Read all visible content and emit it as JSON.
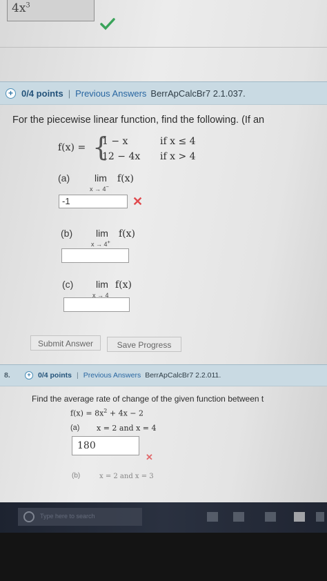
{
  "prev_answer": {
    "value": "4x",
    "exponent": "3"
  },
  "q7": {
    "points": "0/4 points",
    "separator": "|",
    "previous_answers": "Previous Answers",
    "code": "BerrApCalcBr7 2.1.037.",
    "prompt": "For the piecewise linear function, find the following. (If an",
    "func_name": "f(x) =",
    "piece1_expr": "1 − x",
    "piece1_cond": "if x ≤ 4",
    "piece2_expr": "12 − 4x",
    "piece2_cond": "if x > 4",
    "parts": [
      {
        "label": "(a)",
        "lim": "lim",
        "sub": "x → 4",
        "sup": "−",
        "fx": "f(x)",
        "answer": "-1",
        "marked_wrong": true
      },
      {
        "label": "(b)",
        "lim": "lim",
        "sub": "x → 4",
        "sup": "+",
        "fx": "f(x)",
        "answer": "",
        "marked_wrong": false
      },
      {
        "label": "(c)",
        "lim": "lim",
        "sub": "x → 4",
        "sup": "",
        "fx": "f(x)",
        "answer": "",
        "marked_wrong": false
      }
    ],
    "submit_label": "Submit Answer",
    "save_label": "Save Progress"
  },
  "q8": {
    "number": "8.",
    "points": "0/4 points",
    "separator": "|",
    "previous_answers": "Previous Answers",
    "code": "BerrApCalcBr7 2.2.011.",
    "prompt": "Find the average rate of change of the given function between t",
    "func": "f(x) = 8x",
    "func_exp": "2",
    "func_rest": " + 4x − 2",
    "part_a_label": "(a)",
    "part_a_text": "x = 2 and x = 4",
    "part_a_answer": "180",
    "part_b_label": "(b)",
    "part_b_text": "x = 2 and x = 3"
  },
  "taskbar": {
    "search_placeholder": "Type here to search"
  },
  "colors": {
    "header_bg": "#c9dae3",
    "wrong_mark": "#e0484c",
    "correct_mark": "#3aa35a"
  }
}
